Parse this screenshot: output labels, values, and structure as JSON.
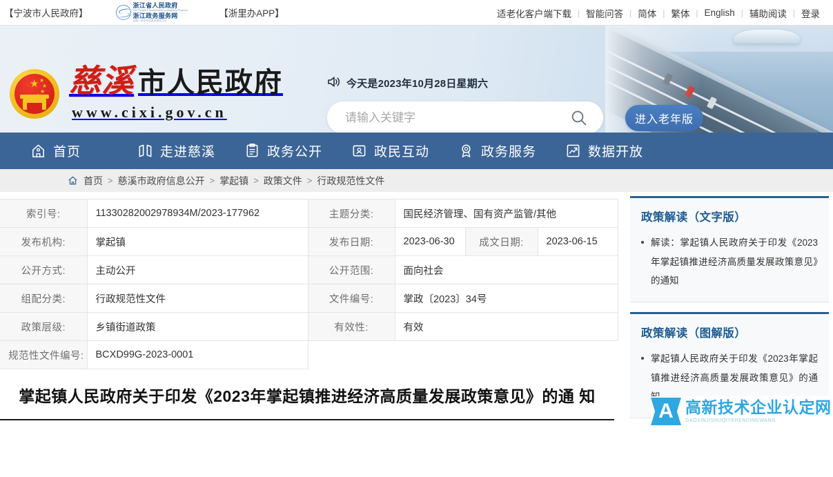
{
  "topbar": {
    "ningbo_gov": "【宁波市人民政府】",
    "zj_logo": {
      "line1": "浙江省人民政府",
      "line1_en": "The People's Government of Zhejiang Province",
      "line2": "浙江政务服务网",
      "line2_en": "全国一体化在线政务服务平台"
    },
    "zheliban": "【浙里办APP】",
    "links": [
      {
        "label": "适老化客户端下载"
      },
      {
        "label": "智能问答"
      },
      {
        "label": "简体"
      },
      {
        "label": "繁体"
      },
      {
        "label": "English"
      },
      {
        "label": "辅助阅读"
      },
      {
        "label": "登录"
      }
    ],
    "separator": "|"
  },
  "header": {
    "site_name_accent": "慈溪",
    "site_name_rest": "市人民政府",
    "site_url": "www.cixi.gov.cn",
    "date_text": "今天是2023年10月28日星期六",
    "search": {
      "placeholder": "请输入关键字",
      "value": ""
    },
    "elder_button": "进入老年版"
  },
  "mainnav": {
    "items": [
      {
        "label": "首页",
        "icon": "home-icon"
      },
      {
        "label": "走进慈溪",
        "icon": "map-icon"
      },
      {
        "label": "政务公开",
        "icon": "clipboard-icon"
      },
      {
        "label": "政民互动",
        "icon": "user-card-icon"
      },
      {
        "label": "政务服务",
        "icon": "medal-icon"
      },
      {
        "label": "数据开放",
        "icon": "chart-icon"
      }
    ]
  },
  "breadcrumb": {
    "items": [
      "首页",
      "慈溪市政府信息公开",
      "掌起镇",
      "政策文件",
      "行政规范性文件"
    ],
    "separator": ">"
  },
  "info_table": {
    "rows": [
      {
        "cells": [
          {
            "type": "label",
            "text": "索引号:"
          },
          {
            "type": "value",
            "text": "11330282002978934M/2023-177962"
          },
          {
            "type": "label",
            "text": "主题分类:"
          },
          {
            "type": "value",
            "text": "国民经济管理、国有资产监管/其他"
          }
        ]
      },
      {
        "cells": [
          {
            "type": "label",
            "text": "发布机构:"
          },
          {
            "type": "value",
            "text": "掌起镇"
          },
          {
            "type": "label",
            "text": "发布日期:"
          },
          {
            "type": "value",
            "text": "2023-06-30"
          },
          {
            "type": "label",
            "text": "成文日期:"
          },
          {
            "type": "value",
            "text": "2023-06-15"
          }
        ]
      },
      {
        "cells": [
          {
            "type": "label",
            "text": "公开方式:"
          },
          {
            "type": "value",
            "text": "主动公开"
          },
          {
            "type": "label",
            "text": "公开范围:"
          },
          {
            "type": "value",
            "text": "面向社会"
          }
        ]
      },
      {
        "cells": [
          {
            "type": "label",
            "text": "组配分类:"
          },
          {
            "type": "value",
            "text": "行政规范性文件"
          },
          {
            "type": "label",
            "text": "文件编号:"
          },
          {
            "type": "value",
            "text": "掌政〔2023〕34号"
          }
        ]
      },
      {
        "cells": [
          {
            "type": "label",
            "text": "政策层级:"
          },
          {
            "type": "value",
            "text": "乡镇街道政策"
          },
          {
            "type": "label",
            "text": "有效性:"
          },
          {
            "type": "value",
            "text": "有效"
          }
        ]
      },
      {
        "cells": [
          {
            "type": "label",
            "text": "规范性文件编号:"
          },
          {
            "type": "value",
            "text": "BCXD99G-2023-0001"
          }
        ]
      }
    ]
  },
  "document": {
    "title_line1": "掌起镇人民政府关于印发《2023年掌起镇推进经济高质量发展政策意见》的通",
    "title_line2": "知"
  },
  "sidebar": {
    "panels": [
      {
        "title": "政策解读（文字版）",
        "items": [
          "解读：掌起镇人民政府关于印发《2023年掌起镇推进经济高质量发展政策意见》的通知"
        ]
      },
      {
        "title": "政策解读（图解版）",
        "items": [
          "掌起镇人民政府关于印发《2023年掌起镇推进经济高质量发展政策意见》的通知"
        ]
      }
    ]
  },
  "watermark": {
    "letter": "A",
    "cn": "高新技术企业认定网",
    "en": "GAOXINJISHUQIYERENDINGWANG"
  },
  "colors": {
    "nav_blue": "#3c6597",
    "panel_border": "#2c5f8f",
    "panel_title": "#1f5c92",
    "accent_red": "#cf1e16",
    "watermark_blue": "#2fa7e0",
    "breadcrumb_bg": "#eeeeee",
    "label_bg": "#f7f7f7"
  }
}
